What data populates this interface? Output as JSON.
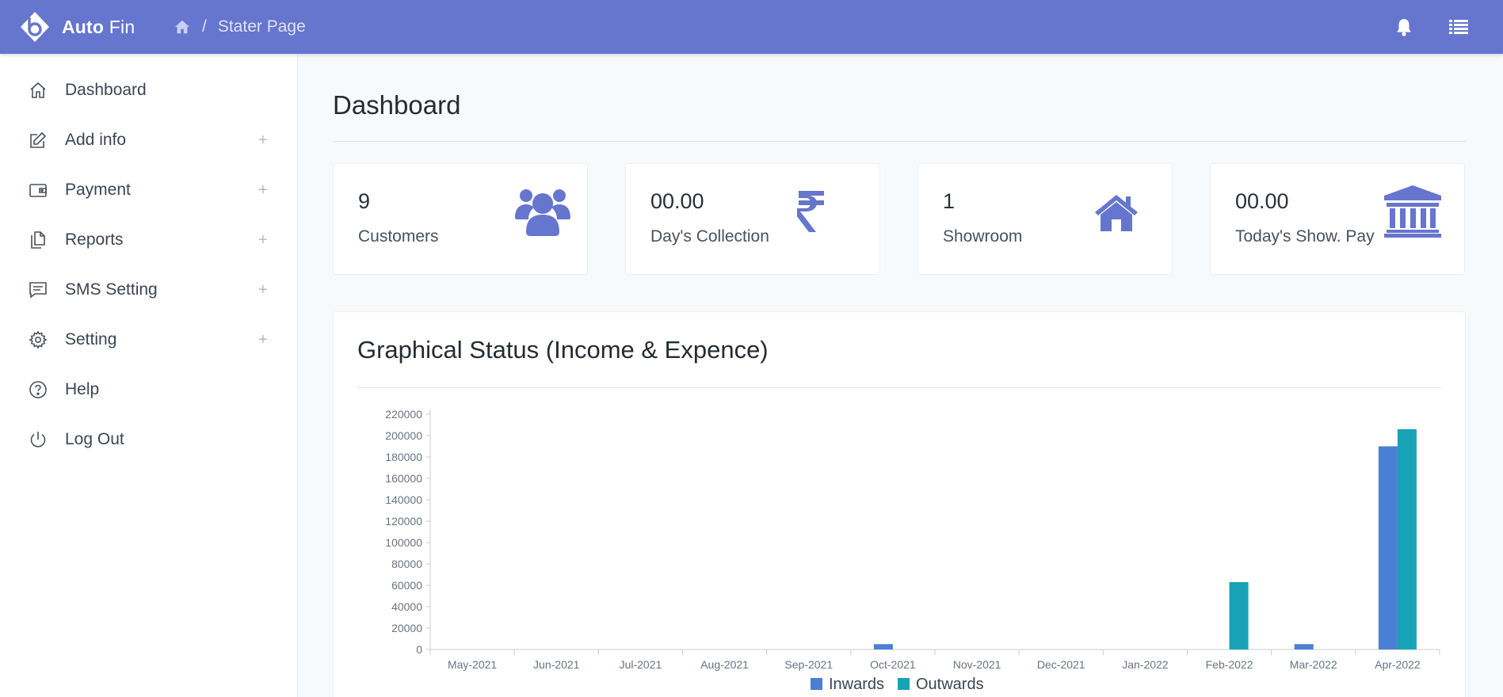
{
  "brand": {
    "name_bold": "Auto",
    "name_light": "Fin"
  },
  "breadcrumb": {
    "current": "Stater Page"
  },
  "sidebar": {
    "items": [
      {
        "label": "Dashboard",
        "icon": "home-icon",
        "expandable": false
      },
      {
        "label": "Add info",
        "icon": "edit-icon",
        "expandable": true
      },
      {
        "label": "Payment",
        "icon": "wallet-icon",
        "expandable": true
      },
      {
        "label": "Reports",
        "icon": "document-icon",
        "expandable": true
      },
      {
        "label": "SMS Setting",
        "icon": "message-icon",
        "expandable": true
      },
      {
        "label": "Setting",
        "icon": "gear-icon",
        "expandable": true
      },
      {
        "label": "Help",
        "icon": "help-icon",
        "expandable": false
      },
      {
        "label": "Log Out",
        "icon": "power-icon",
        "expandable": false
      }
    ],
    "expand_symbol": "+"
  },
  "page": {
    "title": "Dashboard"
  },
  "cards": [
    {
      "value": "9",
      "label": "Customers",
      "icon": "users-icon"
    },
    {
      "value": "00.00",
      "label": "Day's Collection",
      "icon": "rupee-icon"
    },
    {
      "value": "1",
      "label": "Showroom",
      "icon": "house-icon"
    },
    {
      "value": "00.00",
      "label": "Today's Show. Pay",
      "icon": "bank-icon"
    }
  ],
  "chart_section": {
    "title": "Graphical Status (Income & Expence)"
  },
  "colors": {
    "accent": "#6675cd",
    "inwards": "#4a7fd4",
    "outwards": "#17a2b8"
  },
  "chart_data": {
    "type": "bar",
    "categories": [
      "May-2021",
      "Jun-2021",
      "Jul-2021",
      "Aug-2021",
      "Sep-2021",
      "Oct-2021",
      "Nov-2021",
      "Dec-2021",
      "Jan-2022",
      "Feb-2022",
      "Mar-2022",
      "Apr-2022"
    ],
    "series": [
      {
        "name": "Inwards",
        "values": [
          0,
          0,
          0,
          0,
          0,
          5000,
          0,
          0,
          0,
          0,
          5000,
          190000
        ]
      },
      {
        "name": "Outwards",
        "values": [
          0,
          0,
          0,
          0,
          0,
          0,
          0,
          0,
          0,
          63000,
          0,
          206000
        ]
      }
    ],
    "yticks": [
      0,
      20000,
      40000,
      60000,
      80000,
      100000,
      120000,
      140000,
      160000,
      180000,
      200000,
      220000
    ],
    "ylim": [
      0,
      220000
    ],
    "legend": "bottom-center"
  }
}
